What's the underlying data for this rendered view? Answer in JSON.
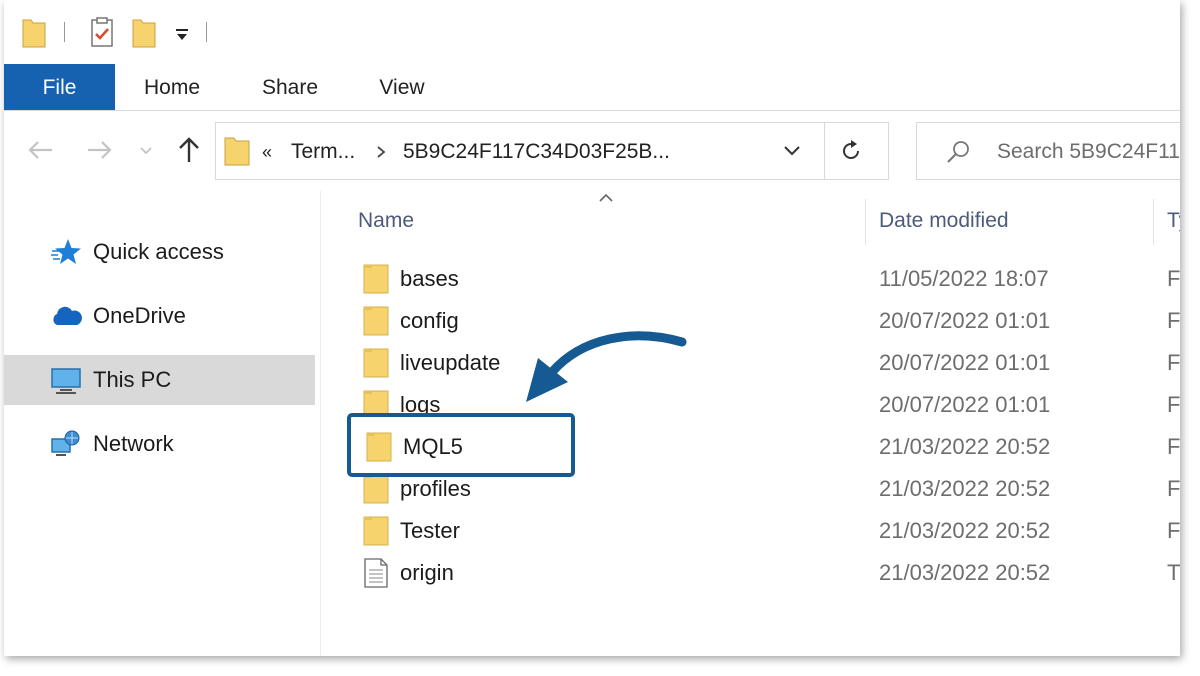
{
  "ribbon": {
    "tabs": [
      "File",
      "Home",
      "Share",
      "View"
    ]
  },
  "address": {
    "overflow": "«",
    "crumb1": "Term...",
    "crumb2": "5B9C24F117C34D03F25B...",
    "search_placeholder": "Search 5B9C24F11"
  },
  "nav_pane": {
    "items": [
      "Quick access",
      "OneDrive",
      "This PC",
      "Network"
    ],
    "selected": "This PC"
  },
  "columns": {
    "name": "Name",
    "date": "Date modified",
    "type": "Ty"
  },
  "files": [
    {
      "name": "bases",
      "date": "11/05/2022 18:07",
      "type": "F",
      "kind": "folder"
    },
    {
      "name": "config",
      "date": "20/07/2022 01:01",
      "type": "F",
      "kind": "folder"
    },
    {
      "name": "liveupdate",
      "date": "20/07/2022 01:01",
      "type": "F",
      "kind": "folder"
    },
    {
      "name": "logs",
      "date": "20/07/2022 01:01",
      "type": "F",
      "kind": "folder"
    },
    {
      "name": "MQL5",
      "date": "21/03/2022 20:52",
      "type": "F",
      "kind": "folder"
    },
    {
      "name": "profiles",
      "date": "21/03/2022 20:52",
      "type": "F",
      "kind": "folder"
    },
    {
      "name": "Tester",
      "date": "21/03/2022 20:52",
      "type": "F",
      "kind": "folder"
    },
    {
      "name": "origin",
      "date": "21/03/2022 20:52",
      "type": "T",
      "kind": "file"
    }
  ],
  "highlighted": "MQL5",
  "colors": {
    "file_tab": "#1661b0",
    "highlight": "#155a92",
    "folder": "#f7d36e",
    "selection": "#d9d9d9"
  }
}
